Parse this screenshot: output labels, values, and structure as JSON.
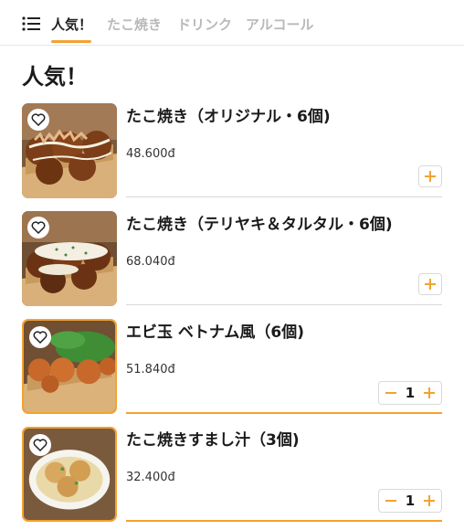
{
  "tabs": [
    {
      "label": "人気！"
    },
    {
      "label": "たこ焼き"
    },
    {
      "label": "ドリンク"
    },
    {
      "label": "アルコール"
    }
  ],
  "section": {
    "title": "人気！"
  },
  "items": [
    {
      "name": "たこ焼き（オリジナル・6個)",
      "price": "48.600đ",
      "quantity": null
    },
    {
      "name": "たこ焼き（テリヤキ＆タルタル・6個)",
      "price": "68.040đ",
      "quantity": null
    },
    {
      "name": "エビ玉 ベトナム風（6個)",
      "price": "51.840đ",
      "quantity": "1"
    },
    {
      "name": "たこ焼きすまし汁（3個)",
      "price": "32.400đ",
      "quantity": "1"
    }
  ],
  "colors": {
    "accent": "#f3a230",
    "text": "#1a1a1a",
    "muted": "#b9b9b9"
  },
  "icons": [
    "menu-icon",
    "heart-icon",
    "plus-icon",
    "minus-icon"
  ]
}
